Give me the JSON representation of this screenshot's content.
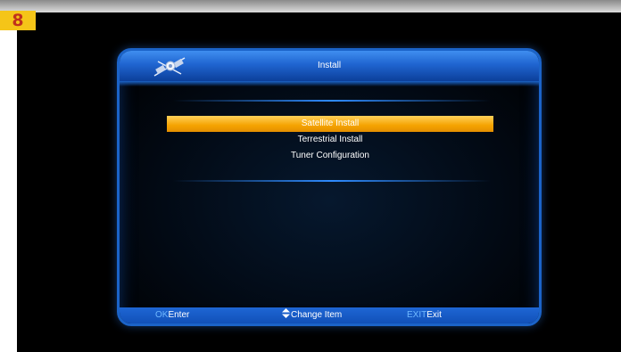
{
  "badge": {
    "number": "8"
  },
  "window": {
    "title": "Install"
  },
  "menu": {
    "items": [
      {
        "label": "Satellite Install",
        "selected": true
      },
      {
        "label": "Terrestrial Install",
        "selected": false
      },
      {
        "label": "Tuner Configuration",
        "selected": false
      }
    ]
  },
  "footer": {
    "ok_key": "OK",
    "ok_label": "Enter",
    "change_icon": "up-down-arrow-icon",
    "change_label": "Change Item",
    "exit_key": "EXIT",
    "exit_label": "Exit"
  },
  "colors": {
    "selection": "#f5a300",
    "frame": "#1b63c8",
    "key_hint": "#6fb8ff",
    "badge_bg": "#f5c518",
    "badge_text": "#c0311c"
  }
}
